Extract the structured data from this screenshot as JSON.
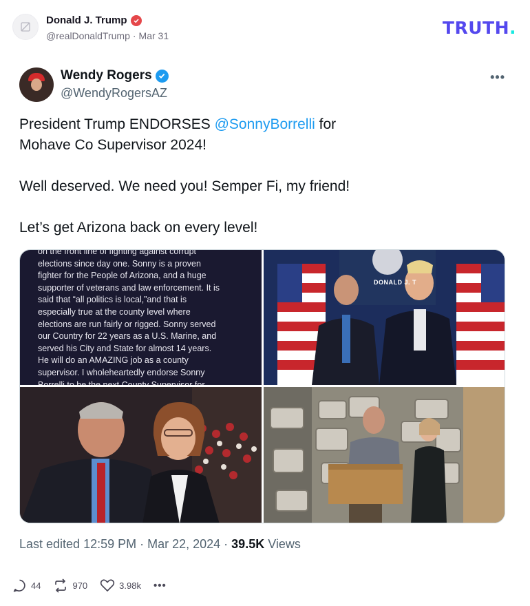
{
  "truth_post": {
    "author_name": "Donald J. Trump",
    "author_handle": "@realDonaldTrump",
    "separator": "·",
    "date": "Mar 31",
    "logo_text": "TRUTH",
    "logo_dot": ".",
    "colors": {
      "logo": "#5448ee",
      "logo_dot": "#17e9e1",
      "badge": "#e5474a"
    }
  },
  "tweet": {
    "author_name": "Wendy Rogers",
    "author_handle": "@WendyRogersAZ",
    "more_label": "•••",
    "line1_prefix": "President Trump ENDORSES ",
    "mention": "@SonnyBorrelli",
    "line1_suffix": " for",
    "line2": "Mohave Co Supervisor 2024!",
    "paragraph2": "Well deserved. We need you! Semper Fi, my friend!",
    "paragraph3": "Let’s get Arizona back on every level!",
    "quote_lines": [
      "on the front line of fighting against corrupt",
      "elections since day one. Sonny is a proven",
      "fighter for the People of Arizona, and a huge",
      "supporter of veterans and law enforcement. It is",
      "said that “all politics is local,”and that is",
      "especially true at the county level where",
      "elections are run fairly or rigged. Sonny served",
      "our Country for 22 years as a U.S. Marine, and",
      "served his City and State for almost 14 years.",
      "He will do an AMAZING job as a county",
      "supervisor. I wholeheartedly endorse Sonny",
      "Borrelli to be the next County Supervisor for"
    ],
    "photo2_sign_text": "DONALD J. T",
    "last_edited_label": "Last edited 12:59 PM · Mar 22, 2024 · ",
    "views_count": "39.5K",
    "views_label": " Views",
    "colors": {
      "mention": "#1d9bf0",
      "verified": "#1d9bf0"
    }
  },
  "actions": {
    "replies": "44",
    "retruths": "970",
    "likes": "3.98k",
    "more": "•••"
  }
}
